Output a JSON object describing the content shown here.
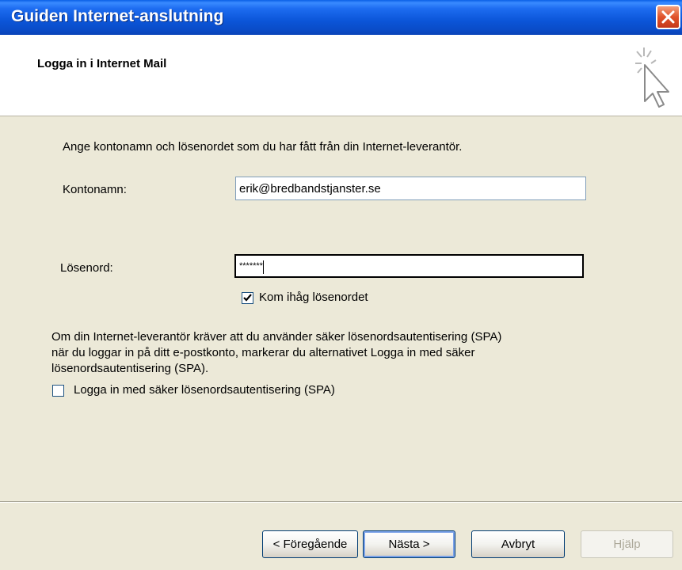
{
  "window": {
    "title": "Guiden Internet-anslutning"
  },
  "header": {
    "title": "Logga in i Internet Mail",
    "icon": "sparkle-cursor-icon"
  },
  "form": {
    "instructions": "Ange kontonamn och lösenordet som du har fått från din Internet-leverantör.",
    "account_label": "Kontonamn:",
    "account_value": "erik@bredbandstjanster.se",
    "password_label": "Lösenord:",
    "password_value": "*******",
    "remember_label": "Kom ihåg lösenordet",
    "remember_checked": true,
    "spa_text_line1": "Om din Internet-leverantör kräver att du använder säker lösenordsautentisering (SPA)",
    "spa_text_line2": "när du loggar in på ditt e-postkonto, markerar du alternativet Logga in med säker",
    "spa_text_line3": "lösenordsautentisering (SPA).",
    "spa_label": "Logga in med säker lösenordsautentisering (SPA)",
    "spa_checked": false
  },
  "buttons": {
    "back": "< Föregående",
    "next": "Nästa >",
    "cancel": "Avbryt",
    "help": "Hjälp"
  },
  "colors": {
    "titlebar": "#0a55d8",
    "dialog_bg": "#ece9d8",
    "close": "#e0522a"
  }
}
